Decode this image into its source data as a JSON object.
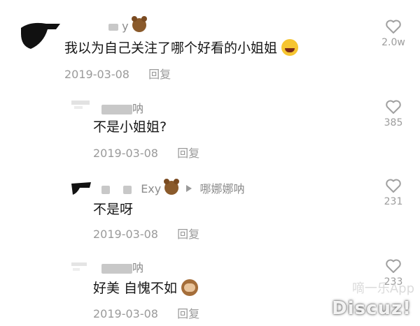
{
  "comments": [
    {
      "username_suffix": "y",
      "text": "我以为自己关注了哪个好看的小姐姐",
      "date": "2019-03-08",
      "reply_label": "回复",
      "likes": "2.0w"
    },
    {
      "username_suffix": "呐",
      "text": "不是小姐姐?",
      "date": "2019-03-08",
      "reply_label": "回复",
      "likes": "385"
    },
    {
      "username_suffix": "Exy",
      "reply_to": "哪娜娜呐",
      "text": "不是呀",
      "date": "2019-03-08",
      "reply_label": "回复",
      "likes": "231"
    },
    {
      "username_suffix": "呐",
      "text": "好美 自愧不如",
      "date": "2019-03-08",
      "reply_label": "回复",
      "likes": "233"
    }
  ],
  "watermark": {
    "text": "Discuz!",
    "faint_text": "嘀一乐App"
  },
  "icons": {
    "like": "heart-outline-icon",
    "bear_emoji": "bear-emoji-icon",
    "laugh_emoji": "laughing-tears-emoji-icon",
    "monkey_emoji": "see-no-evil-monkey-emoji-icon",
    "reply_arrow": "reply-arrow-icon"
  },
  "colors": {
    "text": "#161616",
    "meta": "#9a9a9a",
    "icon": "#a0a0a0"
  }
}
